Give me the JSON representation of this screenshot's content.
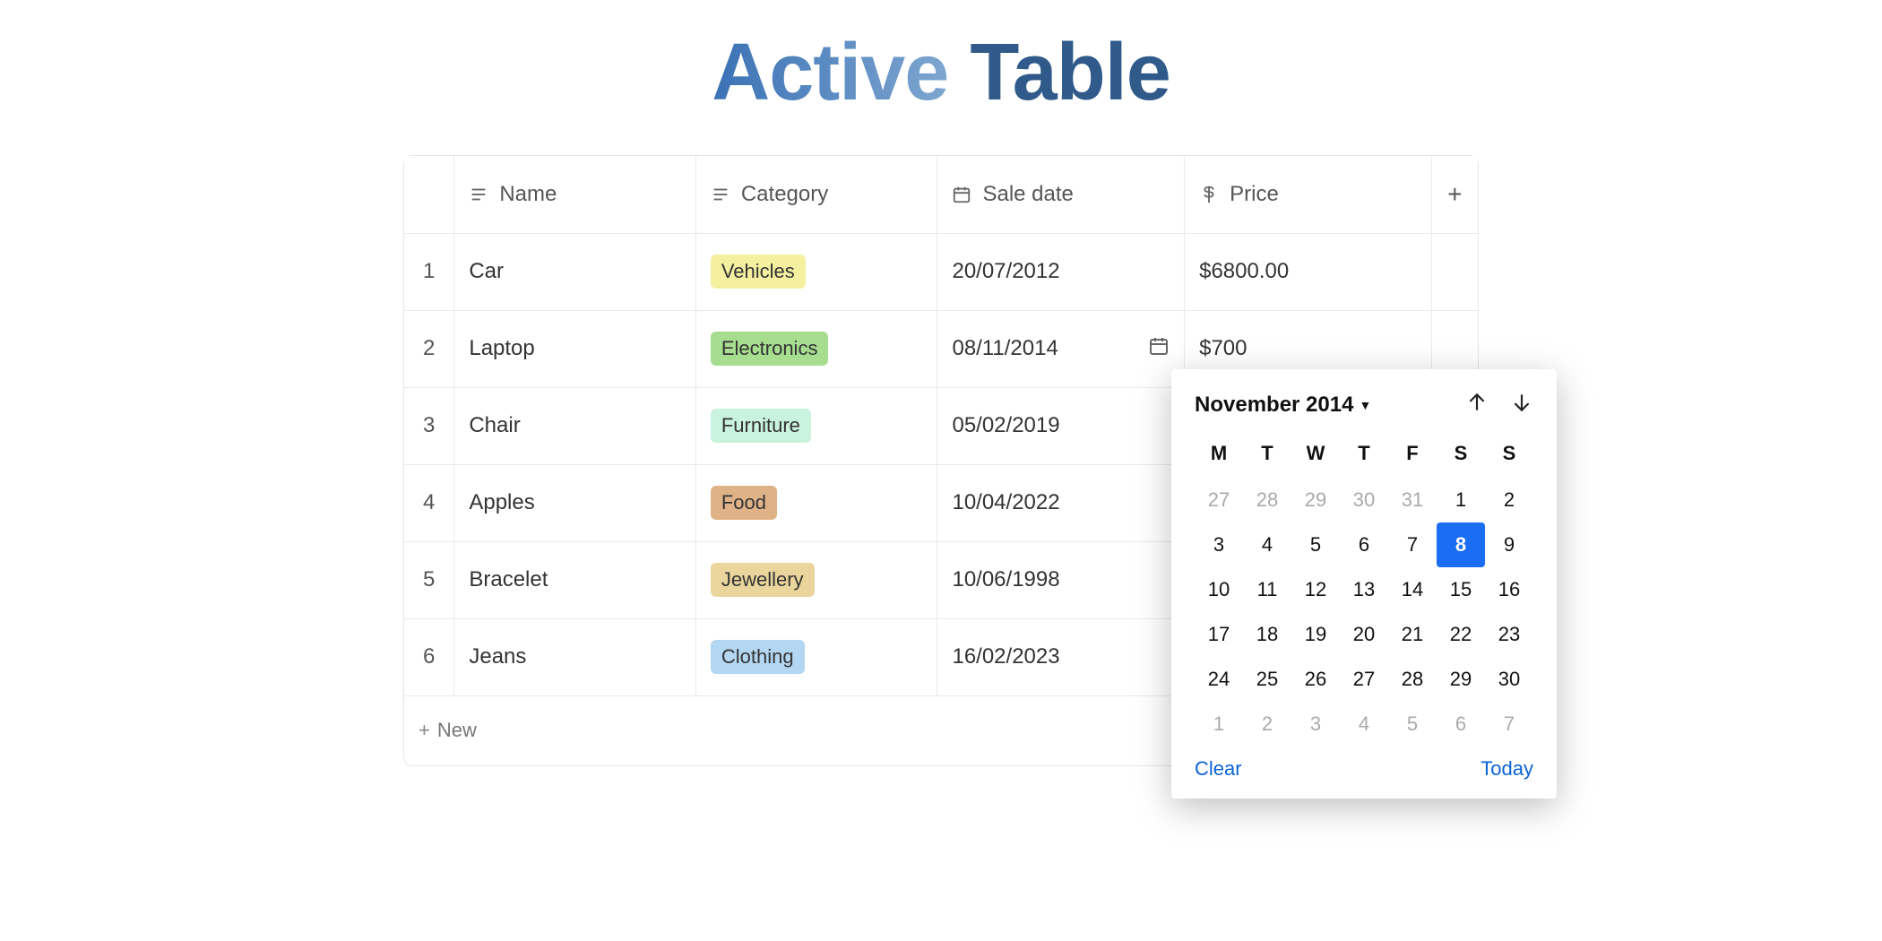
{
  "title": {
    "word1": "Active",
    "word2": "Table"
  },
  "columns": {
    "name": "Name",
    "category": "Category",
    "sale_date": "Sale date",
    "price": "Price",
    "add_column": "+"
  },
  "rows": [
    {
      "idx": "1",
      "name": "Car",
      "category": "Vehicles",
      "cat_color": "#f4f0a0",
      "date": "20/07/2012",
      "price": "$6800.00"
    },
    {
      "idx": "2",
      "name": "Laptop",
      "category": "Electronics",
      "cat_color": "#a6dd8f",
      "date": "08/11/2014",
      "price": "$700"
    },
    {
      "idx": "3",
      "name": "Chair",
      "category": "Furniture",
      "cat_color": "#c9f2df",
      "date": "05/02/2019",
      "price": ""
    },
    {
      "idx": "4",
      "name": "Apples",
      "category": "Food",
      "cat_color": "#e0b288",
      "date": "10/04/2022",
      "price": ""
    },
    {
      "idx": "5",
      "name": "Bracelet",
      "category": "Jewellery",
      "cat_color": "#ead59c",
      "date": "10/06/1998",
      "price": ""
    },
    {
      "idx": "6",
      "name": "Jeans",
      "category": "Clothing",
      "cat_color": "#b3d7f2",
      "date": "16/02/2023",
      "price": ""
    }
  ],
  "active_date_row": 1,
  "new_row_label": "New",
  "datepicker": {
    "title": "November 2014",
    "dows": [
      "M",
      "T",
      "W",
      "T",
      "F",
      "S",
      "S"
    ],
    "weeks": [
      [
        {
          "d": "27",
          "off": true
        },
        {
          "d": "28",
          "off": true
        },
        {
          "d": "29",
          "off": true
        },
        {
          "d": "30",
          "off": true
        },
        {
          "d": "31",
          "off": true
        },
        {
          "d": "1"
        },
        {
          "d": "2"
        }
      ],
      [
        {
          "d": "3"
        },
        {
          "d": "4"
        },
        {
          "d": "5"
        },
        {
          "d": "6"
        },
        {
          "d": "7"
        },
        {
          "d": "8",
          "sel": true
        },
        {
          "d": "9"
        }
      ],
      [
        {
          "d": "10"
        },
        {
          "d": "11"
        },
        {
          "d": "12"
        },
        {
          "d": "13"
        },
        {
          "d": "14"
        },
        {
          "d": "15"
        },
        {
          "d": "16"
        }
      ],
      [
        {
          "d": "17"
        },
        {
          "d": "18"
        },
        {
          "d": "19"
        },
        {
          "d": "20"
        },
        {
          "d": "21"
        },
        {
          "d": "22"
        },
        {
          "d": "23"
        }
      ],
      [
        {
          "d": "24"
        },
        {
          "d": "25"
        },
        {
          "d": "26"
        },
        {
          "d": "27"
        },
        {
          "d": "28"
        },
        {
          "d": "29"
        },
        {
          "d": "30"
        }
      ],
      [
        {
          "d": "1",
          "off": true
        },
        {
          "d": "2",
          "off": true
        },
        {
          "d": "3",
          "off": true
        },
        {
          "d": "4",
          "off": true
        },
        {
          "d": "5",
          "off": true
        },
        {
          "d": "6",
          "off": true
        },
        {
          "d": "7",
          "off": true
        }
      ]
    ],
    "clear": "Clear",
    "today": "Today"
  }
}
